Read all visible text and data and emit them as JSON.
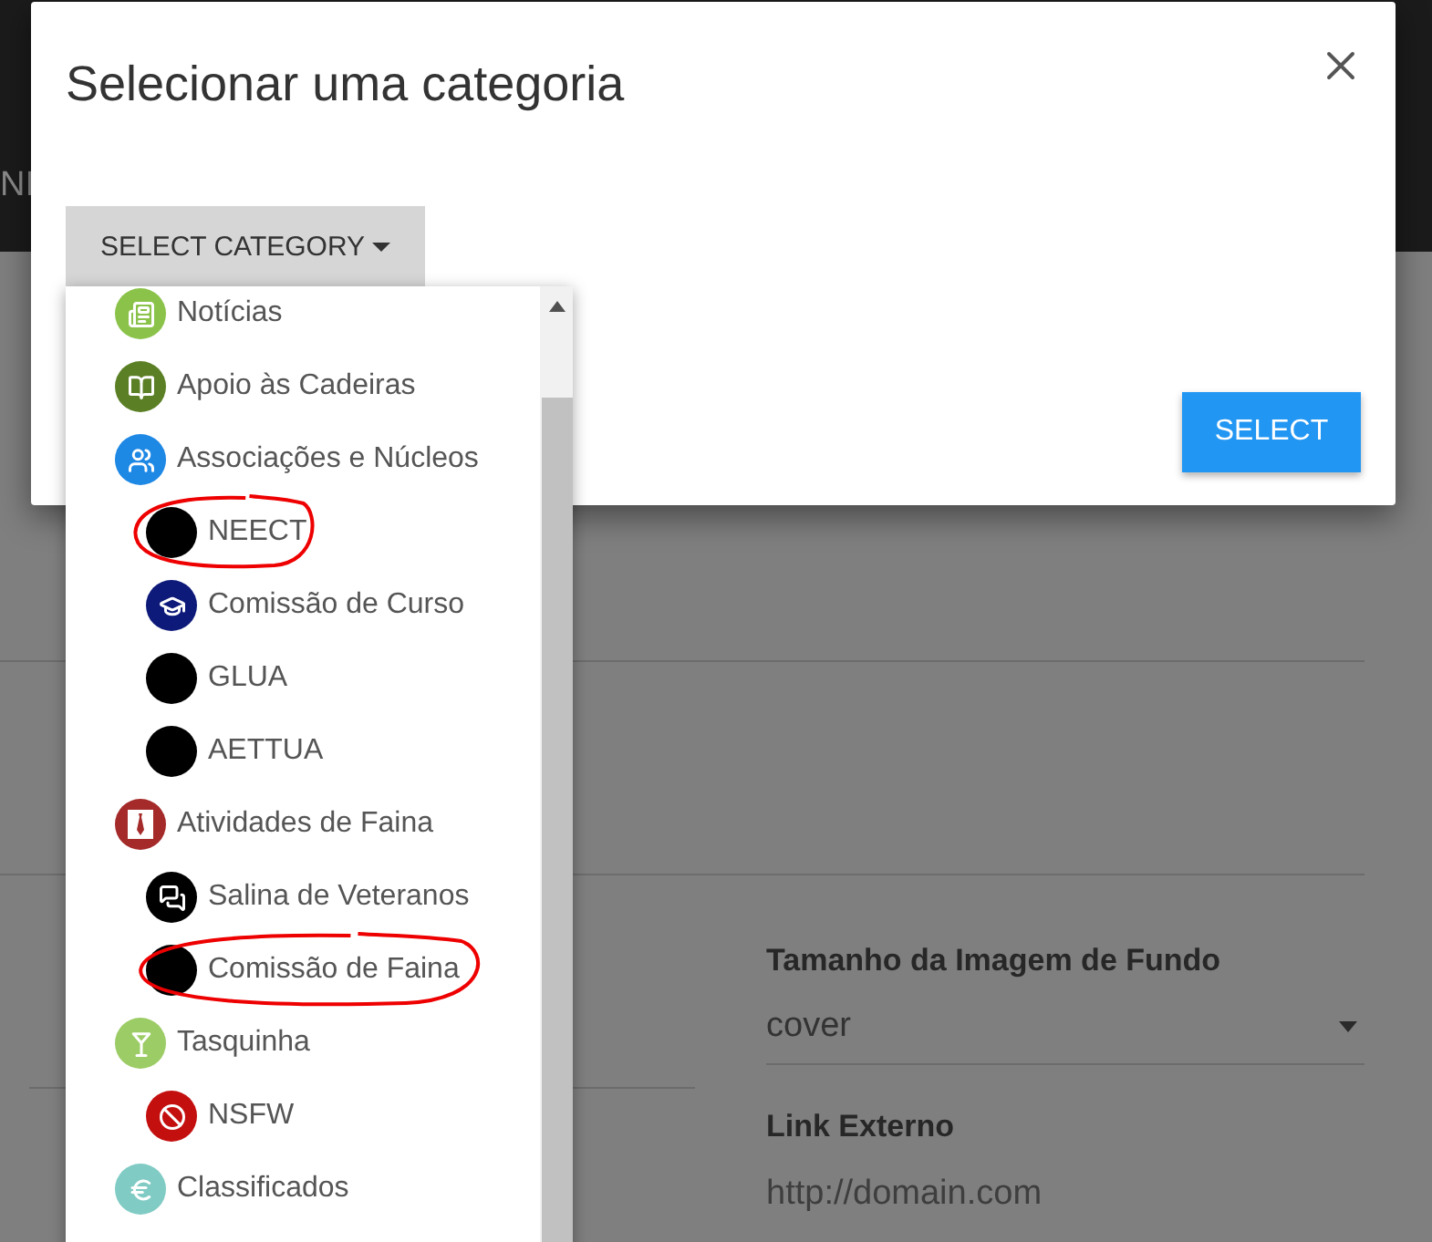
{
  "navbar": {
    "text": "NI"
  },
  "dialog": {
    "title": "Selecionar uma categoria",
    "dropdown_button": "SELECT CATEGORY",
    "select_button": "SELECT"
  },
  "categories": [
    {
      "label": "Notícias",
      "color": "#8bc34a",
      "annotated": false
    },
    {
      "label": "Apoio às Cadeiras",
      "color": "#5b7f24",
      "annotated": false
    },
    {
      "label": "Associações e Núcleos",
      "color": "#1e88e5",
      "annotated": false,
      "children": [
        {
          "label": "NEECT",
          "color": "#000000",
          "annotated": true
        },
        {
          "label": "Comissão de Curso",
          "color": "#0d1a7a",
          "annotated": false
        },
        {
          "label": "GLUA",
          "color": "#000000",
          "annotated": false
        },
        {
          "label": "AETTUA",
          "color": "#000000",
          "annotated": false
        }
      ]
    },
    {
      "label": "Atividades de Faina",
      "color": "#a52a2a",
      "annotated": false,
      "children": [
        {
          "label": "Salina de Veteranos",
          "color": "#000000",
          "annotated": false
        },
        {
          "label": "Comissão de Faina",
          "color": "#000000",
          "annotated": true
        }
      ]
    },
    {
      "label": "Tasquinha",
      "color": "#9ccc65",
      "annotated": false,
      "children": [
        {
          "label": "NSFW",
          "color": "#c40f0f",
          "annotated": false
        }
      ]
    },
    {
      "label": "Classificados",
      "color": "#80cbc4",
      "annotated": false
    }
  ],
  "form": {
    "size_label": "Tamanho da Imagem de Fundo",
    "size_value": "cover",
    "link_label": "Link Externo",
    "link_placeholder": "http://domain.com"
  }
}
